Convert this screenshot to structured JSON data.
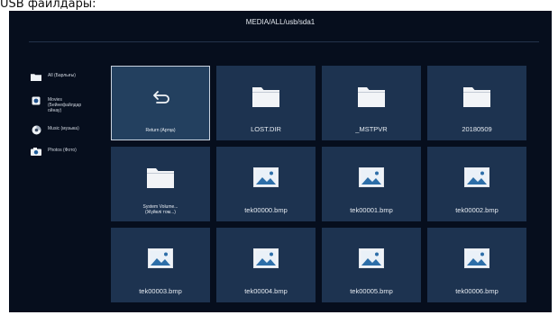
{
  "caption": "USB файлдары:",
  "header": {
    "path": "MEDIA/ALL/usb/sda1"
  },
  "sidebar": {
    "items": [
      {
        "label": "All (Барлығы)",
        "icon": "folder-icon"
      },
      {
        "label": "Movies\n(Бейнефайлдар\nойнау)",
        "icon": "movie-icon"
      },
      {
        "label": "Music (музыка)",
        "icon": "music-icon"
      },
      {
        "label": "Photos (Фото)",
        "icon": "photo-icon"
      }
    ]
  },
  "tiles": [
    {
      "label": "Return (Артқа)",
      "icon": "return-icon",
      "selected": true
    },
    {
      "label": "LOST.DIR",
      "icon": "folder-icon"
    },
    {
      "label": "_MSTPVR",
      "icon": "folder-icon"
    },
    {
      "label": "20180509",
      "icon": "folder-icon"
    },
    {
      "label": "System Volume...\n(Жүйелі том...)",
      "icon": "folder-icon"
    },
    {
      "label": "tek00000.bmp",
      "icon": "image-icon"
    },
    {
      "label": "tek00001.bmp",
      "icon": "image-icon"
    },
    {
      "label": "tek00002.bmp",
      "icon": "image-icon"
    },
    {
      "label": "tek00003.bmp",
      "icon": "image-icon"
    },
    {
      "label": "tek00004.bmp",
      "icon": "image-icon"
    },
    {
      "label": "tek00005.bmp",
      "icon": "image-icon"
    },
    {
      "label": "tek00006.bmp",
      "icon": "image-icon"
    }
  ],
  "colors": {
    "screen": "#060e1d",
    "tile": "#1d3350",
    "tile_selected": "#23405f",
    "text": "#e6ebf1"
  }
}
